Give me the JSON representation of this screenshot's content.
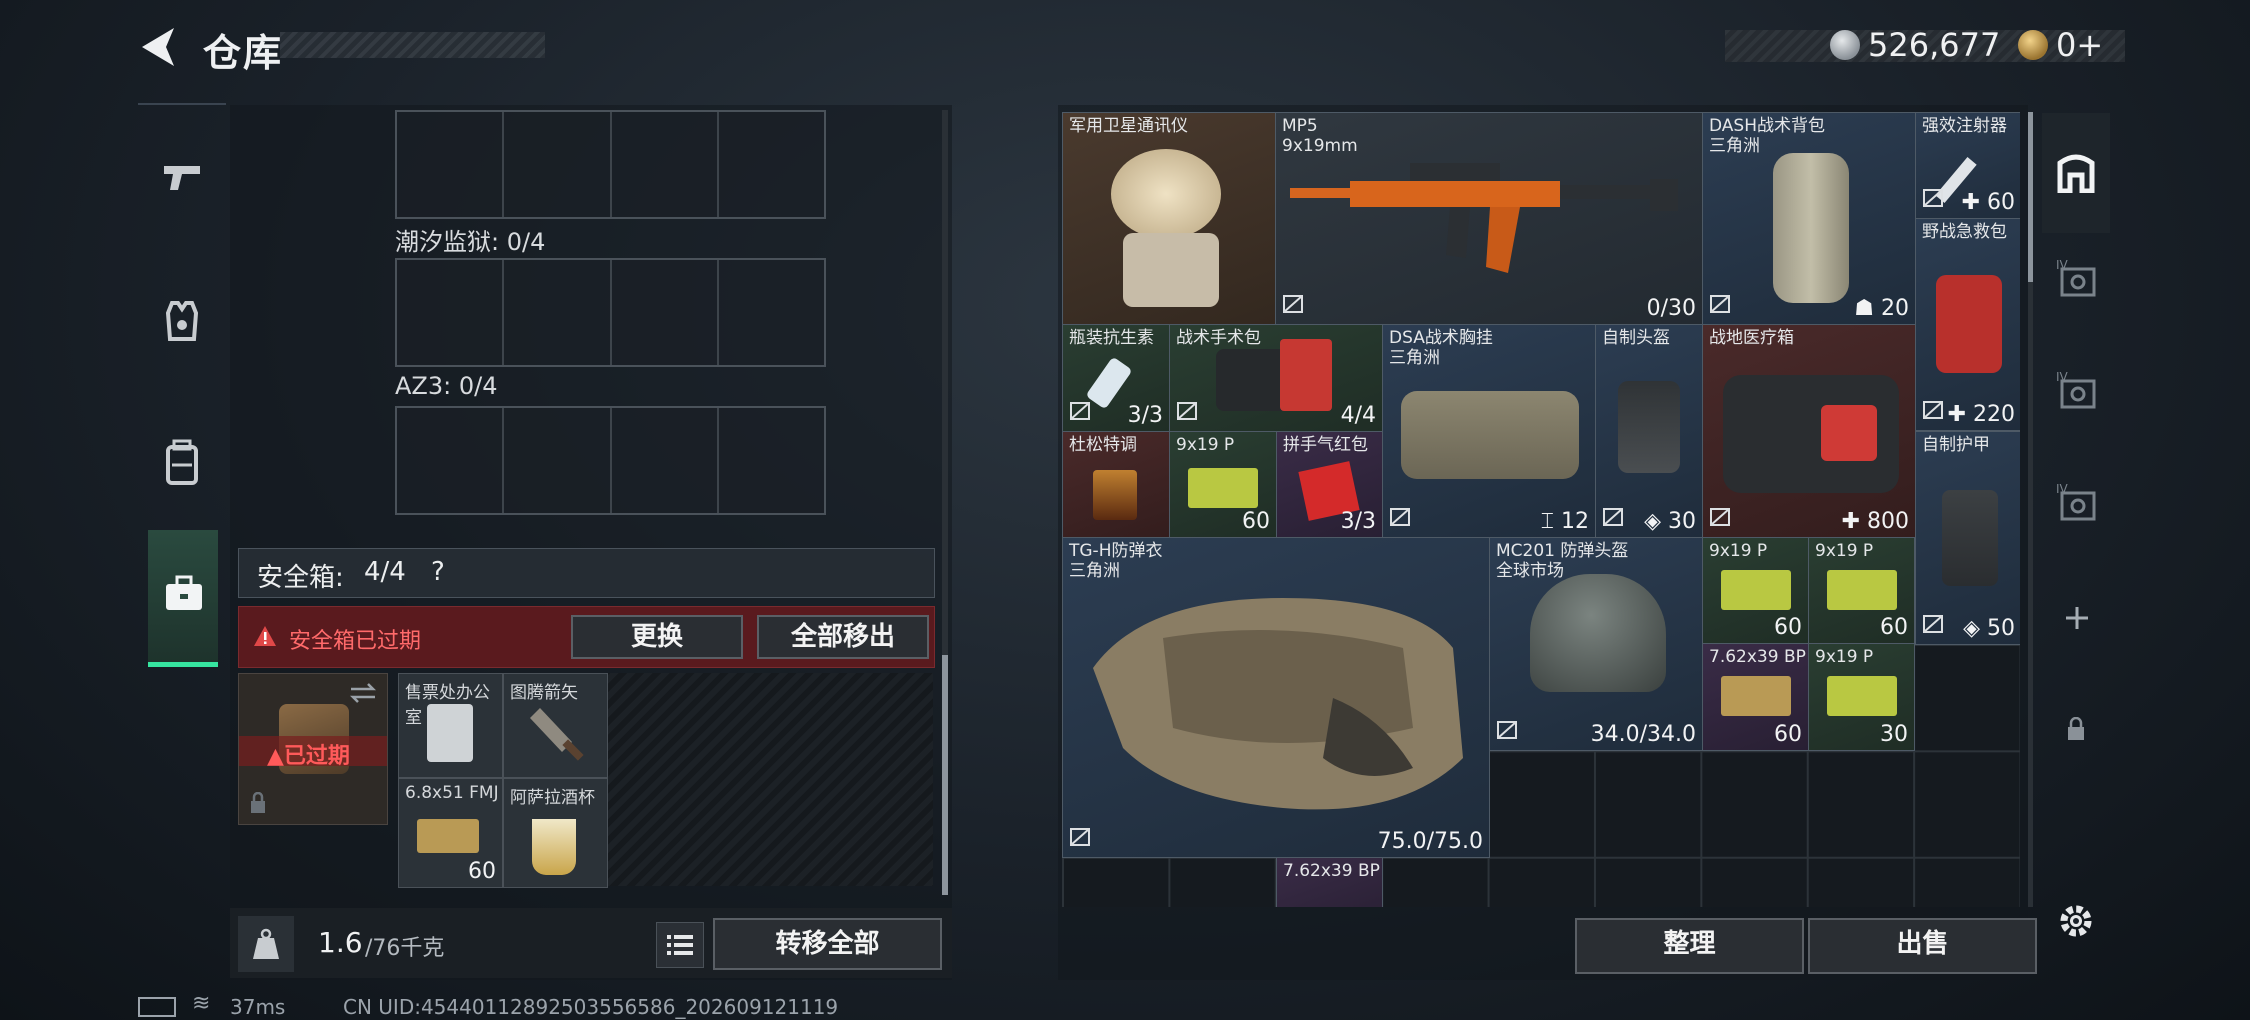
{
  "header": {
    "title": "仓库",
    "currency_silver": "526,677",
    "currency_gold": "0+"
  },
  "left_panel": {
    "slot_labels": [
      "潮汐监狱: 0/4",
      "AZ3: 0/4"
    ],
    "safebox": {
      "label": "安全箱:",
      "count": "4/4",
      "help": "?",
      "expired_text": "安全箱已过期",
      "replace_btn": "更换",
      "remove_all_btn": "全部移出",
      "badge_expired": "已过期",
      "items": [
        {
          "name": "售票处办公室",
          "value": ""
        },
        {
          "name": "图腾箭矢",
          "value": ""
        },
        {
          "name": "6.8x51 FMJ",
          "value": "60"
        },
        {
          "name": "阿萨拉酒杯",
          "value": ""
        }
      ]
    },
    "weight": "1.6",
    "weight_max": "/76千克",
    "transfer_all_btn": "转移全部"
  },
  "right_panel": {
    "items": [
      {
        "name": "军用卫星通讯仪",
        "sub": "",
        "value": ""
      },
      {
        "name": "MP5",
        "sub": "9x19mm",
        "value": "0/30"
      },
      {
        "name": "DASH战术背包",
        "sub": "三角洲",
        "value": "20"
      },
      {
        "name": "强效注射器",
        "sub": "",
        "value": "60"
      },
      {
        "name": "野战急救包",
        "sub": "",
        "value": "220"
      },
      {
        "name": "瓶装抗生素",
        "sub": "",
        "value": "3/3"
      },
      {
        "name": "战术手术包",
        "sub": "",
        "value": "4/4"
      },
      {
        "name": "DSA战术胸挂",
        "sub": "三角洲",
        "value": "12",
        "value2": "30"
      },
      {
        "name": "自制头盔",
        "sub": "",
        "value": ""
      },
      {
        "name": "战地医疗箱",
        "sub": "",
        "value": "800"
      },
      {
        "name": "杜松特调",
        "sub": "",
        "value": ""
      },
      {
        "name": "9x19 P",
        "sub": "",
        "value": "60"
      },
      {
        "name": "拼手气红包",
        "sub": "",
        "value": "3/3"
      },
      {
        "name": "自制护甲",
        "sub": "",
        "value": "50"
      },
      {
        "name": "TG-H防弹衣",
        "sub": "三角洲",
        "value": "75.0/75.0"
      },
      {
        "name": "MC201 防弹头盔",
        "sub": "全球市场",
        "value": "34.0/34.0"
      },
      {
        "name": "9x19 P",
        "sub": "",
        "value": "60"
      },
      {
        "name": "9x19 P",
        "sub": "",
        "value": "60"
      },
      {
        "name": "7.62x39 BP",
        "sub": "",
        "value": "60"
      },
      {
        "name": "9x19 P",
        "sub": "",
        "value": "30"
      },
      {
        "name": "7.62x39 BP",
        "sub": "",
        "value": ""
      }
    ],
    "sort_btn": "整理",
    "sell_btn": "出售"
  },
  "status": {
    "ping": "37ms",
    "uid": "CN UID:45440112892503556586_202609121119"
  },
  "colors": {
    "accent": "#36e5a0",
    "danger": "#e04848"
  }
}
